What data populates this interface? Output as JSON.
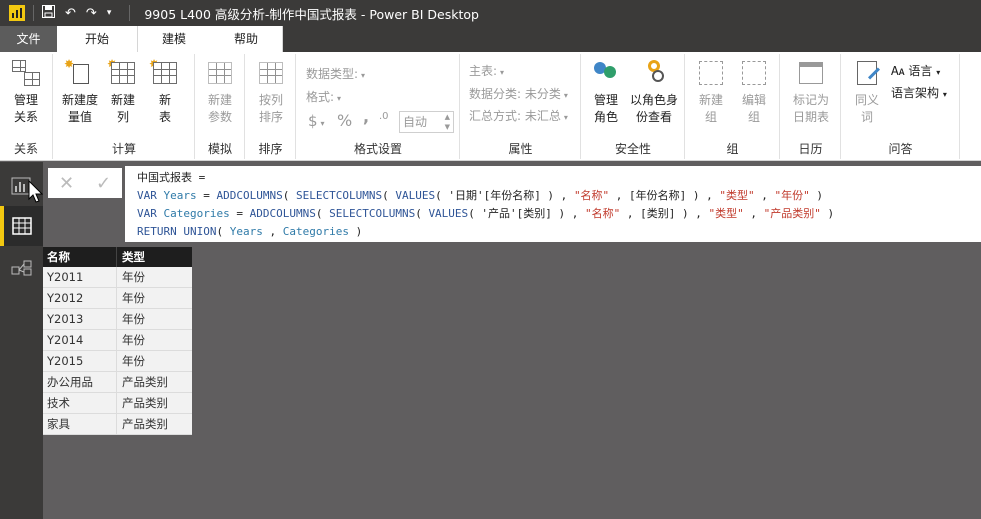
{
  "window": {
    "title": "9905 L400 高级分析-制作中国式报表 - Power BI Desktop"
  },
  "tabs": [
    {
      "label": "文件"
    },
    {
      "label": "开始"
    },
    {
      "label": "建模"
    },
    {
      "label": "帮助"
    }
  ],
  "ribbon": {
    "groups": [
      {
        "label": "关系",
        "buttons": [
          {
            "label": "管理\n关系"
          }
        ]
      },
      {
        "label": "计算",
        "buttons": [
          {
            "label": "新建度\n量值"
          },
          {
            "label": "新建\n列"
          },
          {
            "label": "新\n表"
          }
        ]
      },
      {
        "label": "模拟",
        "buttons": [
          {
            "label": "新建\n参数"
          }
        ]
      },
      {
        "label": "排序",
        "buttons": [
          {
            "label": "按列\n排序"
          }
        ]
      },
      {
        "label": "格式设置"
      },
      {
        "label": "属性"
      },
      {
        "label": "安全性",
        "buttons": [
          {
            "label": "管理\n角色"
          },
          {
            "label": "以角色身\n份查看"
          }
        ]
      },
      {
        "label": "组",
        "buttons": [
          {
            "label": "新建\n组"
          },
          {
            "label": "编辑\n组"
          }
        ]
      },
      {
        "label": "日历",
        "buttons": [
          {
            "label": "标记为\n日期表"
          }
        ]
      },
      {
        "label": "问答",
        "buttons": [
          {
            "label": "同义\n词"
          }
        ]
      }
    ],
    "format": {
      "datatype": "数据类型:",
      "format": "格式:",
      "currency": "$",
      "percent": "%",
      "comma": ",",
      "decimals": ".0",
      "auto": "自动"
    },
    "props": {
      "home_table": "主表:",
      "data_category": "数据分类: 未分类",
      "summarization": "汇总方式: 未汇总"
    },
    "qa": {
      "language": "语言",
      "language_schema": "语言架构"
    }
  },
  "formula": {
    "lines": [
      "中国式报表 =",
      "VAR Years = ADDCOLUMNS( SELECTCOLUMNS( VALUES( '日期'[年份名称] ) , \"名称\" , [年份名称] ) , \"类型\" , \"年份\" )",
      "VAR Categories = ADDCOLUMNS( SELECTCOLUMNS( VALUES( '产品'[类别] ) , \"名称\" , [类别] ) , \"类型\" , \"产品类别\" )",
      "RETURN UNION( Years , Categories )"
    ]
  },
  "table": {
    "columns": [
      "名称",
      "类型"
    ],
    "rows": [
      [
        "Y2011",
        "年份"
      ],
      [
        "Y2012",
        "年份"
      ],
      [
        "Y2013",
        "年份"
      ],
      [
        "Y2014",
        "年份"
      ],
      [
        "Y2015",
        "年份"
      ],
      [
        "办公用品",
        "产品类别"
      ],
      [
        "技术",
        "产品类别"
      ],
      [
        "家具",
        "产品类别"
      ]
    ]
  },
  "icons": [
    "powerbi-logo-icon",
    "save-icon",
    "undo-icon",
    "redo-icon",
    "report-view-icon",
    "data-view-icon",
    "relationship-view-icon",
    "cancel-icon",
    "commit-icon"
  ],
  "colors": {
    "accent": "#f2c811",
    "chrome": "#3b3a39",
    "canvas": "#605e5f",
    "dax_keyword": "#2f5597",
    "dax_string": "#c0392b"
  }
}
